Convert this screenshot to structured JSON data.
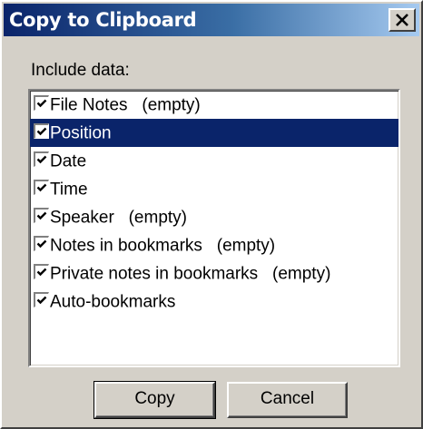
{
  "window": {
    "title": "Copy to Clipboard",
    "close_icon": "close-x-icon"
  },
  "include_label": "Include data:",
  "items": [
    {
      "label": "File Notes   (empty)",
      "checked": true,
      "selected": false
    },
    {
      "label": "Position",
      "checked": true,
      "selected": true
    },
    {
      "label": "Date",
      "checked": true,
      "selected": false
    },
    {
      "label": "Time",
      "checked": true,
      "selected": false
    },
    {
      "label": "Speaker   (empty)",
      "checked": true,
      "selected": false
    },
    {
      "label": "Notes in bookmarks   (empty)",
      "checked": true,
      "selected": false
    },
    {
      "label": "Private notes in bookmarks   (empty)",
      "checked": true,
      "selected": false
    },
    {
      "label": "Auto-bookmarks",
      "checked": true,
      "selected": false
    }
  ],
  "buttons": {
    "copy_label": "Copy",
    "cancel_label": "Cancel"
  },
  "colors": {
    "selection": "#0a246a",
    "face": "#d4d0c8"
  }
}
